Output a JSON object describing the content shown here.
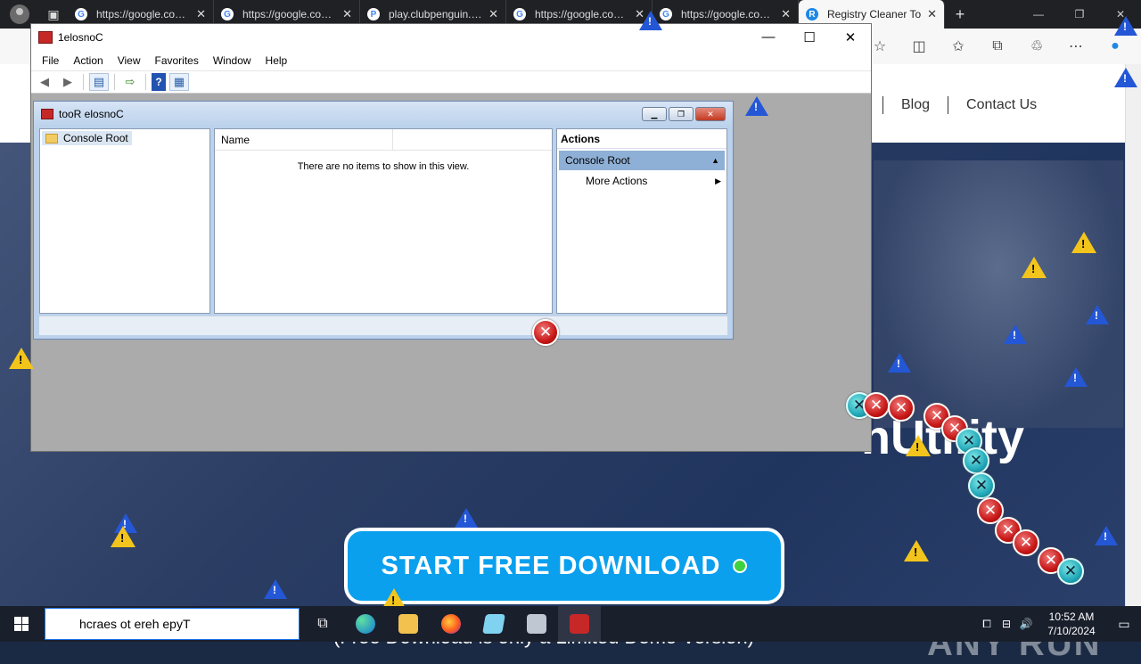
{
  "browser": {
    "tabs": [
      {
        "title": "https://google.co…",
        "favicon": "G",
        "active": false
      },
      {
        "title": "https://google.co…",
        "favicon": "G",
        "active": false
      },
      {
        "title": "play.clubpenguin.…",
        "favicon": "P",
        "active": false
      },
      {
        "title": "https://google.co…",
        "favicon": "G",
        "active": false
      },
      {
        "title": "https://google.co…",
        "favicon": "G",
        "active": false
      },
      {
        "title": "Registry Cleaner To",
        "favicon": "R",
        "active": true
      }
    ],
    "close_glyph": "✕",
    "new_tab_glyph": "+",
    "window_controls": {
      "minimize": "—",
      "restore": "❐",
      "close": "✕"
    },
    "toolbar_icons": [
      "☆",
      "◫",
      "✩",
      "⧉",
      "♲",
      "⋯",
      "●"
    ]
  },
  "website": {
    "nav": {
      "blog": "Blog",
      "contact": "Contact Us"
    },
    "headline_fragment": "nUtility",
    "cta_label": "START FREE DOWNLOAD",
    "cta_note": "(Free Download is only a Limited Demo Version)",
    "watermark": "ANY RUN"
  },
  "mmc": {
    "title": "1elosnoC",
    "menu": [
      "File",
      "Action",
      "View",
      "Favorites",
      "Window",
      "Help"
    ],
    "window_controls": {
      "minimize": "—",
      "maximize": "☐",
      "close": "✕"
    },
    "child": {
      "title": "tooR elosnoC",
      "controls": {
        "minimize": "▁",
        "restore": "❐",
        "close": "✕"
      },
      "tree_root": "Console Root",
      "list_column": "Name",
      "empty_message": "There are no items to show in this view.",
      "actions_header": "Actions",
      "actions_section": "Console Root",
      "actions_item": "More Actions"
    }
  },
  "taskbar": {
    "search_text": "hcraes ot ereh epyT",
    "time": "10:52 AM",
    "date": "7/10/2024",
    "tray_icons": [
      "⧠",
      "⊟",
      "🔊"
    ]
  }
}
